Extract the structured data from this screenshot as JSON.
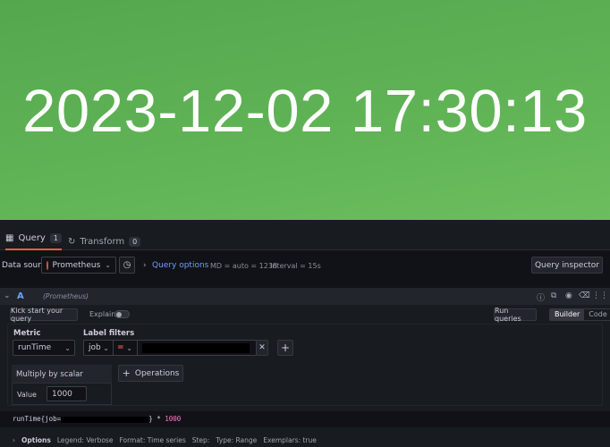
{
  "panel": {
    "time_text": "2023-12-02 17:30:13",
    "bg_color": "#5fb355"
  },
  "tabs": [
    {
      "label": "Query",
      "count": "1",
      "icon": "database-icon"
    },
    {
      "label": "Transform",
      "count": "0",
      "icon": "transform-icon"
    }
  ],
  "datasource": {
    "label": "Data source",
    "selected": "Prometheus",
    "query_options_label": "Query options",
    "md_text": "MD = auto = 1238",
    "interval_text": "Interval = 15s",
    "inspector_label": "Query inspector"
  },
  "query": {
    "ref_id": "A",
    "ds_name": "(Prometheus)",
    "kickstart_label": "Kick start your query",
    "explain_label": "Explain",
    "run_label": "Run queries",
    "mode_builder": "Builder",
    "mode_code": "Code",
    "metric_title": "Metric",
    "metric_value": "runTime",
    "label_filters_title": "Label filters",
    "label_key": "job",
    "label_op": "=",
    "operations_label": "Operations",
    "op_card_title": "Multiply by scalar",
    "op_value_label": "Value",
    "op_value": "1000",
    "code_prefix": "runTime{job=",
    "code_suffix": "} * ",
    "code_number": "1000"
  },
  "options_row": {
    "head": "Options",
    "legend": "Legend: Verbose",
    "format": "Format: Time series",
    "step": "Step:",
    "type": "Type: Range",
    "exemplars": "Exemplars: true"
  }
}
